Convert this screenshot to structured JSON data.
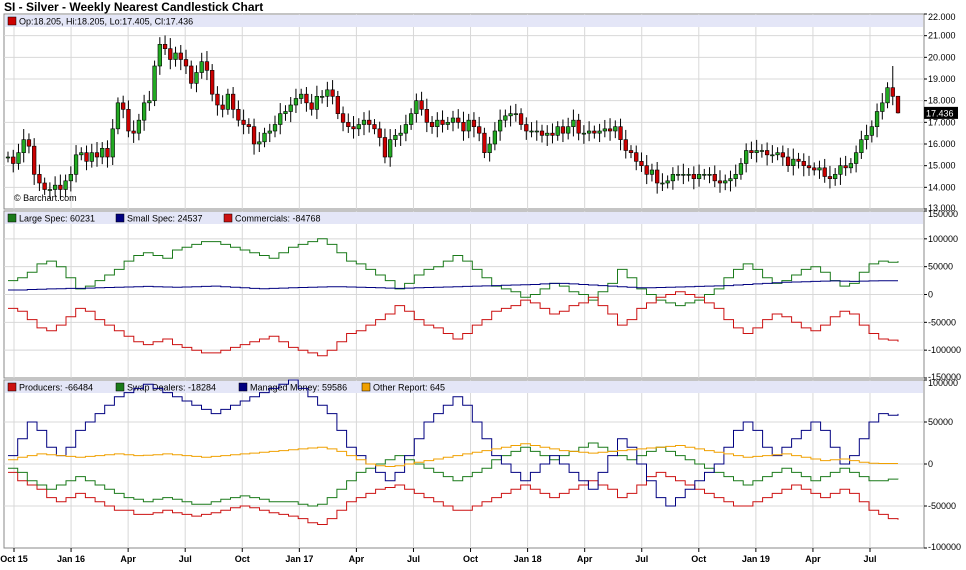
{
  "title": "SI - Silver - Weekly Nearest Candlestick Chart",
  "watermark": "© Barchart.com",
  "colors": {
    "up": "#22aa22",
    "down": "#cc0000",
    "green": "#1a7a1a",
    "blue": "#000080",
    "red": "#cc1111",
    "orange": "#f0a000",
    "grid": "#d8d8d8",
    "legend_bg": "#e4e6f7"
  },
  "x_ticks": [
    "Oct 15",
    "Jan 16",
    "Apr",
    "Jul",
    "Oct",
    "Jan 17",
    "Apr",
    "Jul",
    "Oct",
    "Jan 18",
    "Apr",
    "Jul",
    "Oct",
    "Jan 19",
    "Apr",
    "Jul"
  ],
  "chart_data": [
    {
      "type": "candlestick",
      "legend": [
        {
          "label": "Op:18.205, Hi:18.205, Lo:17.405, Cl:17.436",
          "color": "#cc0000"
        }
      ],
      "last_price_label": "17.436",
      "ylim": [
        13.0,
        22.0
      ],
      "ytick_labels": [
        "22.000",
        "21.000",
        "20.000",
        "19.000",
        "18.000",
        "17.000",
        "16.000",
        "15.000",
        "14.000",
        "13.000"
      ],
      "x_start": "Oct 15",
      "x_end": "Sep 19",
      "closes": [
        15.4,
        15.1,
        15.6,
        16.2,
        15.9,
        14.6,
        14.2,
        13.9,
        13.9,
        14.1,
        13.9,
        14.3,
        14.6,
        15.5,
        15.6,
        15.2,
        15.6,
        15.4,
        15.8,
        15.4,
        16.7,
        17.9,
        17.6,
        16.6,
        16.5,
        17.1,
        17.9,
        18.0,
        19.6,
        20.6,
        20.4,
        19.9,
        20.2,
        19.9,
        19.6,
        18.8,
        19.3,
        19.8,
        19.4,
        18.3,
        17.8,
        17.6,
        18.3,
        17.6,
        17.1,
        16.9,
        16.8,
        16.0,
        16.1,
        16.5,
        16.6,
        16.9,
        17.4,
        17.5,
        17.8,
        18.1,
        18.3,
        17.9,
        17.6,
        18.2,
        18.2,
        18.5,
        18.2,
        17.4,
        17.0,
        16.8,
        16.7,
        16.9,
        17.1,
        16.9,
        16.7,
        16.3,
        15.4,
        16.2,
        16.4,
        16.5,
        16.9,
        17.4,
        18.0,
        17.6,
        17.0,
        16.8,
        17.1,
        16.9,
        17.0,
        17.2,
        17.0,
        16.6,
        17.1,
        16.8,
        16.5,
        15.6,
        16.0,
        16.6,
        17.1,
        17.3,
        17.4,
        17.4,
        16.9,
        16.6,
        16.6,
        16.6,
        16.4,
        16.5,
        16.4,
        16.8,
        16.5,
        16.8,
        17.1,
        16.5,
        16.5,
        16.6,
        16.5,
        16.6,
        16.7,
        16.6,
        16.8,
        16.2,
        15.7,
        15.6,
        15.2,
        15.0,
        14.6,
        14.8,
        14.2,
        14.2,
        14.3,
        14.6,
        14.6,
        14.6,
        14.6,
        14.4,
        14.6,
        14.6,
        14.6,
        14.3,
        14.2,
        14.3,
        14.4,
        14.6,
        15.1,
        15.7,
        15.6,
        15.7,
        15.7,
        15.5,
        15.5,
        15.6,
        15.4,
        15.0,
        15.3,
        15.2,
        15.0,
        14.9,
        14.8,
        14.9,
        14.5,
        14.4,
        14.6,
        15.0,
        14.9,
        15.1,
        15.6,
        16.2,
        16.4,
        16.8,
        17.5,
        17.9,
        18.6,
        18.2,
        17.4
      ],
      "opens": [
        15.4,
        15.4,
        15.1,
        15.6,
        16.2,
        15.9,
        14.6,
        14.2,
        13.9,
        13.9,
        14.1,
        13.9,
        14.3,
        14.6,
        15.5,
        15.6,
        15.2,
        15.6,
        15.4,
        15.8,
        15.4,
        16.7,
        17.9,
        17.6,
        16.6,
        16.5,
        17.1,
        17.9,
        18.0,
        19.6,
        20.6,
        20.4,
        19.9,
        20.2,
        19.9,
        19.6,
        18.8,
        19.3,
        19.8,
        19.4,
        18.3,
        17.8,
        17.6,
        18.3,
        17.6,
        17.1,
        16.9,
        16.8,
        16.0,
        16.1,
        16.5,
        16.6,
        16.9,
        17.4,
        17.5,
        17.8,
        18.1,
        18.3,
        17.9,
        17.6,
        18.2,
        18.2,
        18.5,
        18.2,
        17.4,
        17.0,
        16.8,
        16.7,
        16.9,
        17.1,
        16.9,
        16.7,
        16.3,
        15.4,
        16.2,
        16.4,
        16.5,
        16.9,
        17.4,
        18.0,
        17.6,
        17.0,
        16.8,
        17.1,
        16.9,
        17.0,
        17.2,
        17.0,
        16.6,
        17.1,
        16.8,
        16.5,
        15.6,
        16.0,
        16.6,
        17.1,
        17.3,
        17.4,
        17.4,
        16.9,
        16.6,
        16.6,
        16.6,
        16.4,
        16.5,
        16.4,
        16.8,
        16.5,
        16.8,
        17.1,
        16.5,
        16.5,
        16.6,
        16.5,
        16.6,
        16.7,
        16.6,
        16.8,
        16.2,
        15.7,
        15.6,
        15.2,
        15.0,
        14.6,
        14.8,
        14.2,
        14.2,
        14.3,
        14.6,
        14.6,
        14.6,
        14.6,
        14.4,
        14.6,
        14.6,
        14.6,
        14.3,
        14.2,
        14.3,
        14.4,
        14.6,
        15.1,
        15.7,
        15.6,
        15.7,
        15.7,
        15.5,
        15.5,
        15.6,
        15.4,
        15.0,
        15.3,
        15.2,
        15.0,
        14.9,
        14.8,
        14.9,
        14.5,
        14.4,
        14.6,
        15.0,
        14.9,
        15.1,
        15.6,
        16.2,
        16.4,
        16.8,
        17.5,
        17.9,
        18.6,
        18.205
      ],
      "last_candle": {
        "open": 18.205,
        "high": 18.205,
        "low": 17.405,
        "close": 17.436
      },
      "spike_high": 19.6
    },
    {
      "type": "line",
      "ylim": [
        -150000,
        150000
      ],
      "ytick_labels": [
        "150000",
        "100000",
        "50000",
        "0",
        "-50000",
        "-100000",
        "-150000"
      ],
      "series": [
        {
          "name": "Large Spec: 60231",
          "color": "#1a7a1a",
          "values": [
            25000,
            30000,
            40000,
            55000,
            60000,
            50000,
            30000,
            10000,
            15000,
            25000,
            35000,
            45000,
            60000,
            70000,
            75000,
            70000,
            65000,
            80000,
            85000,
            90000,
            95000,
            95000,
            90000,
            85000,
            80000,
            75000,
            70000,
            65000,
            75000,
            85000,
            90000,
            95000,
            100000,
            90000,
            75000,
            60000,
            55000,
            45000,
            35000,
            25000,
            10000,
            20000,
            35000,
            45000,
            50000,
            60000,
            70000,
            60000,
            45000,
            30000,
            15000,
            10000,
            5000,
            -5000,
            0,
            10000,
            20000,
            15000,
            5000,
            0,
            -10000,
            5000,
            20000,
            45000,
            30000,
            10000,
            0,
            -10000,
            -15000,
            -20000,
            -15000,
            -10000,
            0,
            10000,
            30000,
            45000,
            55000,
            45000,
            30000,
            20000,
            25000,
            35000,
            45000,
            50000,
            40000,
            25000,
            15000,
            20000,
            40000,
            55000,
            60000,
            58000,
            60000
          ]
        },
        {
          "name": "Small Spec: 24537",
          "color": "#000080",
          "values": [
            8000,
            8000,
            9000,
            9500,
            10000,
            10500,
            11000,
            11000,
            11500,
            12000,
            12500,
            13000,
            13500,
            14000,
            14500,
            14000,
            13500,
            13000,
            13500,
            14000,
            14500,
            15000,
            14000,
            13000,
            12000,
            11000,
            10500,
            11000,
            11500,
            12000,
            12500,
            13000,
            13500,
            14000,
            14000,
            13500,
            13000,
            12500,
            12000,
            11500,
            11000,
            11500,
            12000,
            12500,
            13000,
            13500,
            14000,
            14500,
            15000,
            15500,
            16000,
            16500,
            17000,
            17500,
            18000,
            19000,
            20000,
            20000,
            19000,
            18000,
            17000,
            16000,
            15000,
            14000,
            13000,
            12000,
            12000,
            12500,
            13000,
            13500,
            14000,
            14500,
            15000,
            15500,
            16000,
            17000,
            18000,
            19000,
            20000,
            21000,
            22000,
            22500,
            23000,
            23500,
            24000,
            24500,
            24000,
            23500,
            24000,
            24500,
            24537,
            24537,
            24537
          ]
        },
        {
          "name": "Commercials: -84768",
          "color": "#cc1111",
          "values": [
            -25000,
            -30000,
            -45000,
            -60000,
            -65000,
            -55000,
            -40000,
            -25000,
            -30000,
            -45000,
            -55000,
            -65000,
            -75000,
            -85000,
            -90000,
            -85000,
            -80000,
            -90000,
            -95000,
            -100000,
            -105000,
            -105000,
            -100000,
            -95000,
            -90000,
            -85000,
            -80000,
            -75000,
            -85000,
            -95000,
            -100000,
            -105000,
            -110000,
            -100000,
            -85000,
            -70000,
            -65000,
            -55000,
            -45000,
            -35000,
            -20000,
            -30000,
            -45000,
            -55000,
            -60000,
            -70000,
            -80000,
            -70000,
            -55000,
            -45000,
            -30000,
            -25000,
            -20000,
            -10000,
            -15000,
            -25000,
            -35000,
            -30000,
            -20000,
            -15000,
            -5000,
            -20000,
            -35000,
            -55000,
            -45000,
            -25000,
            -15000,
            -5000,
            0,
            5000,
            0,
            -5000,
            -15000,
            -25000,
            -45000,
            -60000,
            -70000,
            -60000,
            -45000,
            -35000,
            -40000,
            -50000,
            -60000,
            -65000,
            -55000,
            -40000,
            -30000,
            -35000,
            -55000,
            -70000,
            -80000,
            -82000,
            -84768
          ]
        }
      ]
    },
    {
      "type": "line",
      "ylim": [
        -100000,
        100000
      ],
      "ytick_labels": [
        "100000",
        "50000",
        "0",
        "-50000",
        "-100000"
      ],
      "series": [
        {
          "name": "Producers: -66484",
          "color": "#cc1111",
          "values": [
            -10000,
            -20000,
            -25000,
            -30000,
            -40000,
            -45000,
            -40000,
            -35000,
            -40000,
            -45000,
            -50000,
            -55000,
            -55000,
            -60000,
            -60000,
            -58000,
            -55000,
            -58000,
            -60000,
            -62000,
            -60000,
            -58000,
            -55000,
            -52000,
            -50000,
            -52000,
            -55000,
            -58000,
            -60000,
            -62000,
            -65000,
            -70000,
            -72000,
            -65000,
            -55000,
            -45000,
            -40000,
            -35000,
            -30000,
            -28000,
            -25000,
            -30000,
            -35000,
            -40000,
            -45000,
            -50000,
            -55000,
            -55000,
            -50000,
            -45000,
            -40000,
            -35000,
            -30000,
            -25000,
            -30000,
            -35000,
            -40000,
            -35000,
            -30000,
            -25000,
            -20000,
            -25000,
            -30000,
            -40000,
            -35000,
            -25000,
            -15000,
            -10000,
            -15000,
            -20000,
            -25000,
            -30000,
            -35000,
            -40000,
            -45000,
            -50000,
            -50000,
            -45000,
            -40000,
            -35000,
            -30000,
            -25000,
            -30000,
            -35000,
            -40000,
            -35000,
            -30000,
            -35000,
            -45000,
            -55000,
            -60000,
            -65000,
            -66484
          ]
        },
        {
          "name": "Swap Dealers: -18284",
          "color": "#1a7a1a",
          "values": [
            -5000,
            -10000,
            -20000,
            -25000,
            -30000,
            -25000,
            -20000,
            -15000,
            -20000,
            -25000,
            -30000,
            -35000,
            -40000,
            -42000,
            -45000,
            -42000,
            -40000,
            -42000,
            -45000,
            -48000,
            -48000,
            -45000,
            -42000,
            -40000,
            -38000,
            -40000,
            -42000,
            -45000,
            -45000,
            -45000,
            -48000,
            -50000,
            -48000,
            -40000,
            -30000,
            -20000,
            -10000,
            -5000,
            0,
            5000,
            10000,
            5000,
            0,
            -5000,
            -10000,
            -15000,
            -20000,
            -15000,
            -10000,
            -5000,
            5000,
            10000,
            15000,
            20000,
            15000,
            10000,
            5000,
            10000,
            15000,
            20000,
            25000,
            20000,
            15000,
            10000,
            5000,
            10000,
            15000,
            20000,
            15000,
            10000,
            5000,
            0,
            -5000,
            -10000,
            -15000,
            -20000,
            -25000,
            -20000,
            -15000,
            -10000,
            -5000,
            -10000,
            -15000,
            -20000,
            -15000,
            -10000,
            -5000,
            -10000,
            -15000,
            -20000,
            -20000,
            -18000,
            -18284
          ]
        },
        {
          "name": "Managed Money: 59586",
          "color": "#000080",
          "values": [
            10000,
            30000,
            50000,
            40000,
            20000,
            10000,
            20000,
            40000,
            50000,
            60000,
            70000,
            80000,
            85000,
            90000,
            95000,
            90000,
            85000,
            80000,
            75000,
            70000,
            65000,
            60000,
            65000,
            70000,
            75000,
            80000,
            85000,
            90000,
            95000,
            100000,
            90000,
            80000,
            70000,
            60000,
            40000,
            20000,
            10000,
            0,
            -10000,
            -20000,
            -10000,
            10000,
            30000,
            50000,
            60000,
            70000,
            80000,
            70000,
            50000,
            30000,
            10000,
            0,
            -10000,
            -20000,
            -10000,
            0,
            10000,
            0,
            -10000,
            -20000,
            -30000,
            -10000,
            10000,
            30000,
            20000,
            0,
            -20000,
            -40000,
            -50000,
            -40000,
            -30000,
            -20000,
            -10000,
            0,
            20000,
            40000,
            50000,
            40000,
            20000,
            10000,
            20000,
            30000,
            40000,
            50000,
            40000,
            20000,
            0,
            10000,
            30000,
            50000,
            60000,
            58000,
            59586
          ]
        },
        {
          "name": "Other Report: 645",
          "color": "#f0a000",
          "values": [
            5000,
            8000,
            10000,
            12000,
            11000,
            10000,
            9000,
            8000,
            9000,
            10000,
            11000,
            12000,
            11000,
            10000,
            10500,
            11000,
            12000,
            11000,
            10000,
            9000,
            8000,
            9000,
            10000,
            11000,
            12000,
            13000,
            14000,
            15000,
            16000,
            17000,
            18000,
            19000,
            20000,
            18000,
            15000,
            10000,
            5000,
            0,
            -2000,
            -3000,
            -2000,
            0,
            2000,
            4000,
            6000,
            8000,
            10000,
            12000,
            14000,
            16000,
            18000,
            20000,
            22000,
            24000,
            22000,
            20000,
            18000,
            16000,
            15000,
            14000,
            13000,
            14000,
            15000,
            16000,
            17000,
            18000,
            19000,
            20000,
            21000,
            22000,
            20000,
            18000,
            16000,
            14000,
            12000,
            10000,
            8000,
            9000,
            10000,
            11000,
            12000,
            10000,
            8000,
            6000,
            4000,
            5000,
            6000,
            4000,
            2000,
            1000,
            645,
            645,
            645
          ]
        }
      ]
    }
  ]
}
